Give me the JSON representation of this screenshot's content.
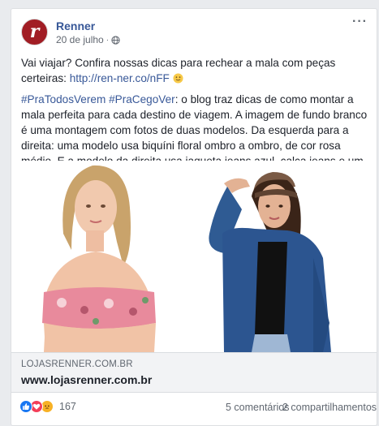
{
  "post": {
    "page_name": "Renner",
    "avatar_letter": "r",
    "date": "20 de julho",
    "meta_separator": "·",
    "privacy_icon": "globe-icon",
    "more_label": "···",
    "text_line1": "Vai viajar? Confira nossas dicas para rechear a mala com peças certeiras:",
    "link": "http://ren-ner.co/nFF",
    "emoji": "slightly-smiling-face",
    "hashtag1": "#PraTodosVerem",
    "hashtag2": "#PraCegoVer",
    "description": ": o blog traz dicas de como montar a mala perfeita para cada destino de viagem. A imagem de fundo branco é uma montagem com fotos de duas modelos. Da esquerda para a direita: uma modelo usa biquíni floral ombro a ombro, de cor rosa médio. E a modelo da direita usa jaqueta jeans azul, calça jeans e um boné marrom."
  },
  "preview": {
    "domain": "LOJASRENNER.COM.BR",
    "title": "www.lojasrenner.com.br"
  },
  "footer": {
    "reaction_icons": [
      "like-icon",
      "love-icon",
      "angry-icon"
    ],
    "reaction_count": "167",
    "comments": "5 comentários",
    "shares": "2 compartilhamentos"
  },
  "colors": {
    "brand": "#a11d24",
    "link": "#385898",
    "like": "#1877f2",
    "love": "#f33e58",
    "angry": "#f7b125"
  }
}
